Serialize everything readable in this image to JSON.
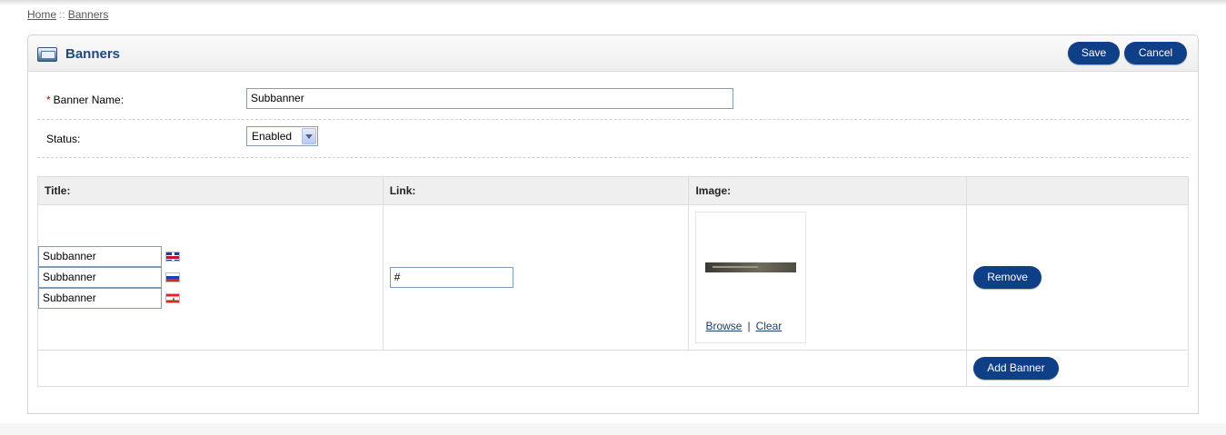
{
  "breadcrumb": {
    "home": "Home",
    "separator": "::",
    "current": "Banners"
  },
  "heading": {
    "title": "Banners",
    "icon": "banner-module-icon"
  },
  "toolbar": {
    "save_label": "Save",
    "cancel_label": "Cancel"
  },
  "form": {
    "required_mark": "*",
    "name_label": "Banner Name:",
    "name_value": "Subbanner",
    "status_label": "Status:",
    "status_value": "Enabled"
  },
  "table": {
    "headers": {
      "title": "Title:",
      "link": "Link:",
      "image": "Image:",
      "action": ""
    },
    "rows": [
      {
        "titles": [
          {
            "value": "Subbanner",
            "flag": "uk-flag-icon"
          },
          {
            "value": "Subbanner",
            "flag": "russia-flag-icon"
          },
          {
            "value": "Subbanner",
            "flag": "lebanon-flag-icon"
          }
        ],
        "link": "#",
        "image": {
          "browse_label": "Browse",
          "separator": "|",
          "clear_label": "Clear"
        },
        "remove_label": "Remove"
      }
    ],
    "add_label": "Add Banner"
  },
  "colors": {
    "button": "#0e3f87",
    "heading_text": "#1f4a7c",
    "required": "#cc0000"
  }
}
